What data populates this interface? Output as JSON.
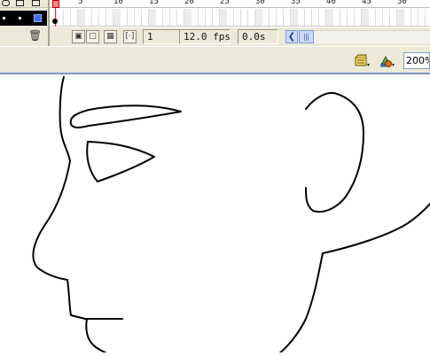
{
  "timeline": {
    "ruler_labels": [
      "5",
      "10",
      "15",
      "20",
      "25",
      "30",
      "35",
      "40",
      "45",
      "50"
    ],
    "current_frame": "1",
    "frame_rate": "12.0 fps",
    "elapsed_time": "0.0s",
    "tool_icons": [
      "center-frame-icon",
      "onion-skin-icon",
      "onion-skin-outlines-icon",
      "edit-multiple-frames-icon",
      "modify-onion-markers-icon"
    ],
    "layer_icons": [
      "eye-icon",
      "lock-icon",
      "outline-icon",
      "trash-icon"
    ]
  },
  "editbar": {
    "zoom": "200%",
    "icons": [
      "edit-scene-icon",
      "edit-symbols-icon"
    ]
  },
  "colors": {
    "panel": "#ece9d8",
    "layer_highlight": "#000000",
    "layer_swatch": "#3e6ff0",
    "playhead": "#e03030",
    "stroke": "#000000"
  },
  "stage": {
    "drawing": "line-art-face"
  }
}
